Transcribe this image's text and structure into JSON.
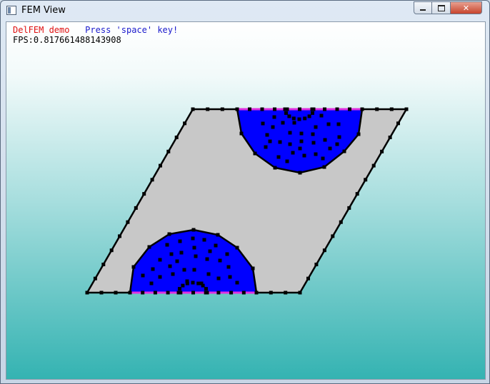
{
  "window": {
    "title": "FEM View",
    "controls": {
      "minimize": "",
      "maximize": "",
      "close": "✕"
    }
  },
  "overlay": {
    "demo_label": "DelFEM demo",
    "instruction": "Press 'space' key!",
    "fps_text": "FPS:0.817661488143908"
  },
  "colors": {
    "domain_fill": "#c8c8c8",
    "region_fill": "#0000ff",
    "boundary": "#000000",
    "fixed_edge": "#e030e0",
    "node": "#000000"
  }
}
